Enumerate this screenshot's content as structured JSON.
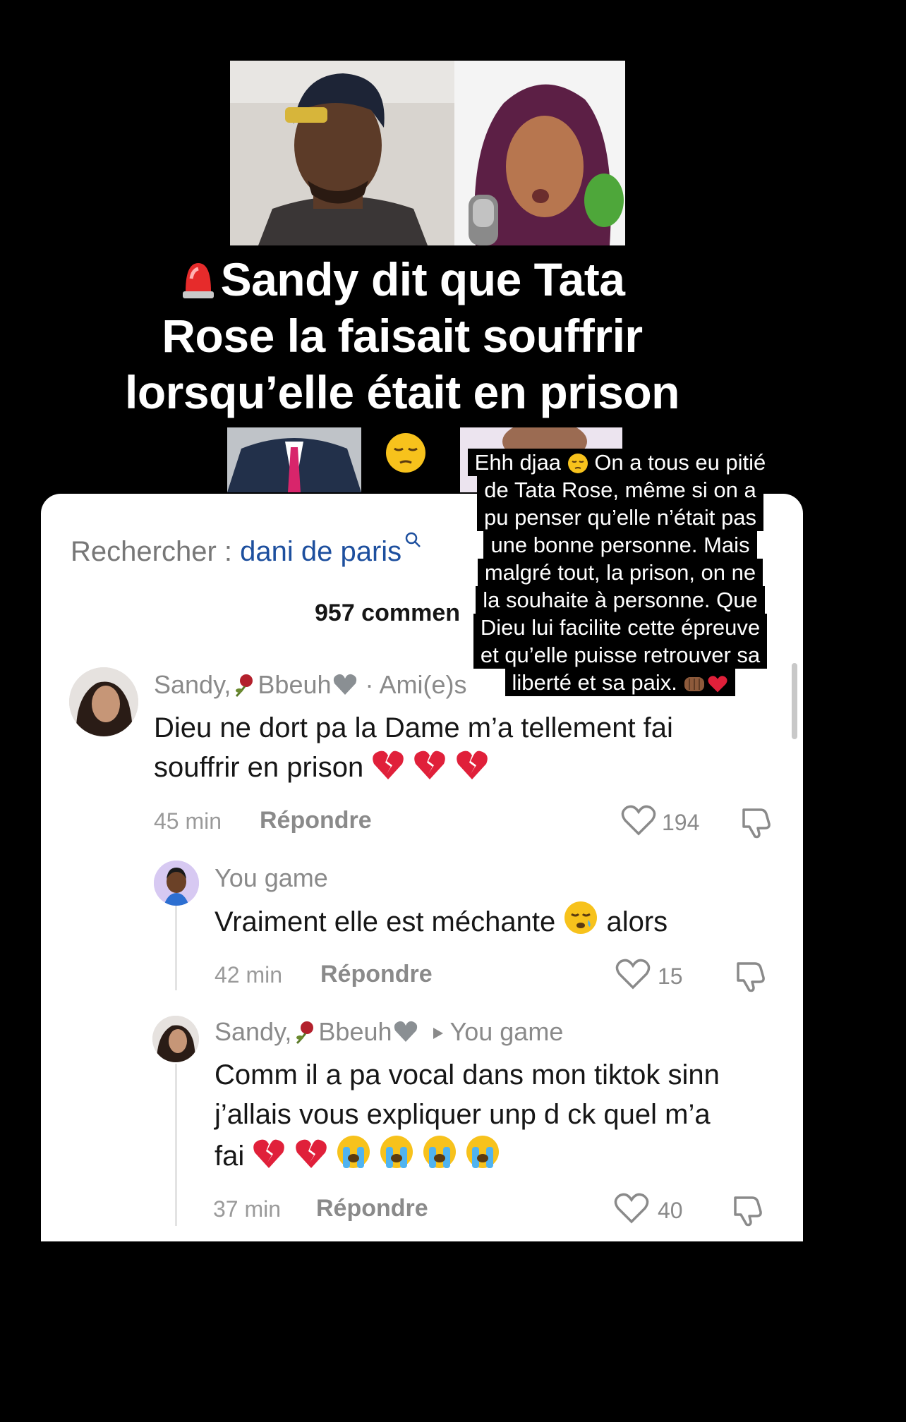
{
  "headline": {
    "line1": "Sandy dit que Tata",
    "line2": "Rose la faisait souffrir",
    "line3": "lorsqu’elle était en prison"
  },
  "search": {
    "label": "Rechercher : ",
    "query": "dani de paris"
  },
  "comments_header": {
    "count_label": "957 commen"
  },
  "caption": {
    "lines": [
      "Ehh djaa",
      "de Tata Rose, même si on a",
      "pu penser qu’elle n’était pas",
      "une bonne personne. Mais",
      "malgré tout, la prison, on ne",
      "la souhaite à personne. Que",
      "Dieu lui facilite cette épreuve",
      "et qu’elle puisse retrouver sa",
      "liberté et sa paix."
    ],
    "line1_tail": "On a tous eu pitié"
  },
  "comments": [
    {
      "user_a": "Sandy,",
      "user_b": "Bbeuh",
      "tag": "· Ami(e)s",
      "text1": "Dieu ne dort pa la Dame m’a tellement fai",
      "text2": "souffrir en prison",
      "time": "45 min",
      "reply": "Répondre",
      "likes": "194"
    },
    {
      "user": "You game",
      "text_a": "Vraiment elle est méchante",
      "text_b": "alors",
      "time": "42 min",
      "reply": "Répondre",
      "likes": "15"
    },
    {
      "user_a": "Sandy,",
      "user_b": "Bbeuh",
      "reply_to": "You game",
      "text1": "Comm il a pa vocal dans mon tiktok sinn",
      "text2": "j’allais vous expliquer unp d ck quel m’a",
      "text3": "fai",
      "time": "37 min",
      "reply": "Répondre",
      "likes": "40"
    }
  ],
  "colors": {
    "link_blue": "#1d4f9e",
    "broken_heart": "#e0203a",
    "background": "#000000",
    "card": "#ffffff"
  }
}
